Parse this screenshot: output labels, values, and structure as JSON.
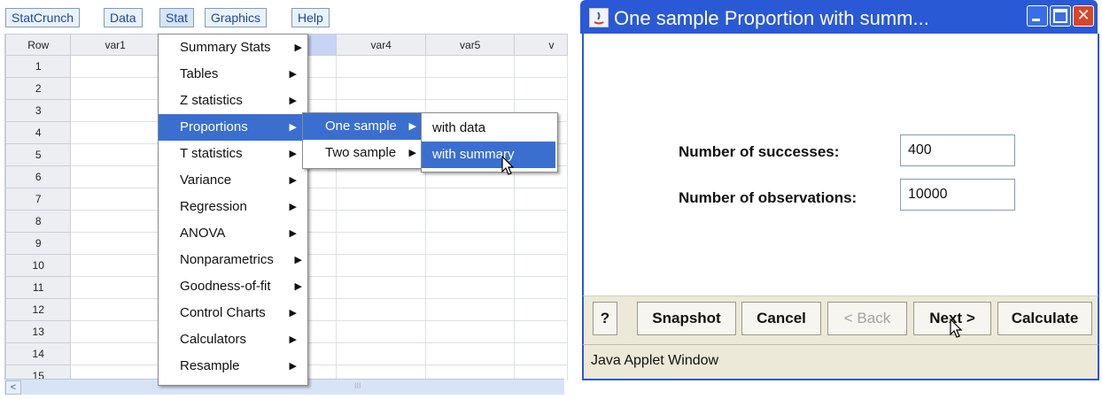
{
  "menubar": {
    "items": [
      {
        "label": "StatCrunch"
      },
      {
        "label": "Data"
      },
      {
        "label": "Stat"
      },
      {
        "label": "Graphics"
      },
      {
        "label": "Help"
      }
    ]
  },
  "grid": {
    "columns": [
      "Row",
      "var1",
      "",
      "",
      "var4",
      "var5",
      "v"
    ],
    "rows": [
      "1",
      "2",
      "3",
      "4",
      "5",
      "6",
      "7",
      "8",
      "9",
      "10",
      "11",
      "12",
      "13",
      "14",
      "15"
    ]
  },
  "stat_menu": {
    "items": [
      {
        "label": "Summary Stats"
      },
      {
        "label": "Tables"
      },
      {
        "label": "Z statistics"
      },
      {
        "label": "Proportions"
      },
      {
        "label": "T statistics"
      },
      {
        "label": "Variance"
      },
      {
        "label": "Regression"
      },
      {
        "label": "ANOVA"
      },
      {
        "label": "Nonparametrics"
      },
      {
        "label": "Goodness-of-fit"
      },
      {
        "label": "Control Charts"
      },
      {
        "label": "Calculators"
      },
      {
        "label": "Resample"
      }
    ]
  },
  "proportions_menu": {
    "items": [
      {
        "label": "One sample"
      },
      {
        "label": "Two sample"
      }
    ]
  },
  "one_sample_menu": {
    "items": [
      {
        "label": "with data"
      },
      {
        "label": "with summary"
      }
    ]
  },
  "scrollbar": {
    "grip": "III"
  },
  "dialog": {
    "title": "One sample Proportion with summ...",
    "close_glyph": "✕",
    "fields": {
      "successes": {
        "label": "Number of successes:",
        "value": "400"
      },
      "observations": {
        "label": "Number of observations:",
        "value": "10000"
      }
    },
    "buttons": {
      "help": "?",
      "snapshot": "Snapshot",
      "cancel": "Cancel",
      "back": "< Back",
      "next": "Next >",
      "calculate": "Calculate"
    },
    "status": "Java Applet Window"
  },
  "colors": {
    "menu_highlight": "#3a6fd0",
    "titlebar": "#2a59d6",
    "close_button": "#d6472b",
    "button_bar": "#ece9d8"
  }
}
